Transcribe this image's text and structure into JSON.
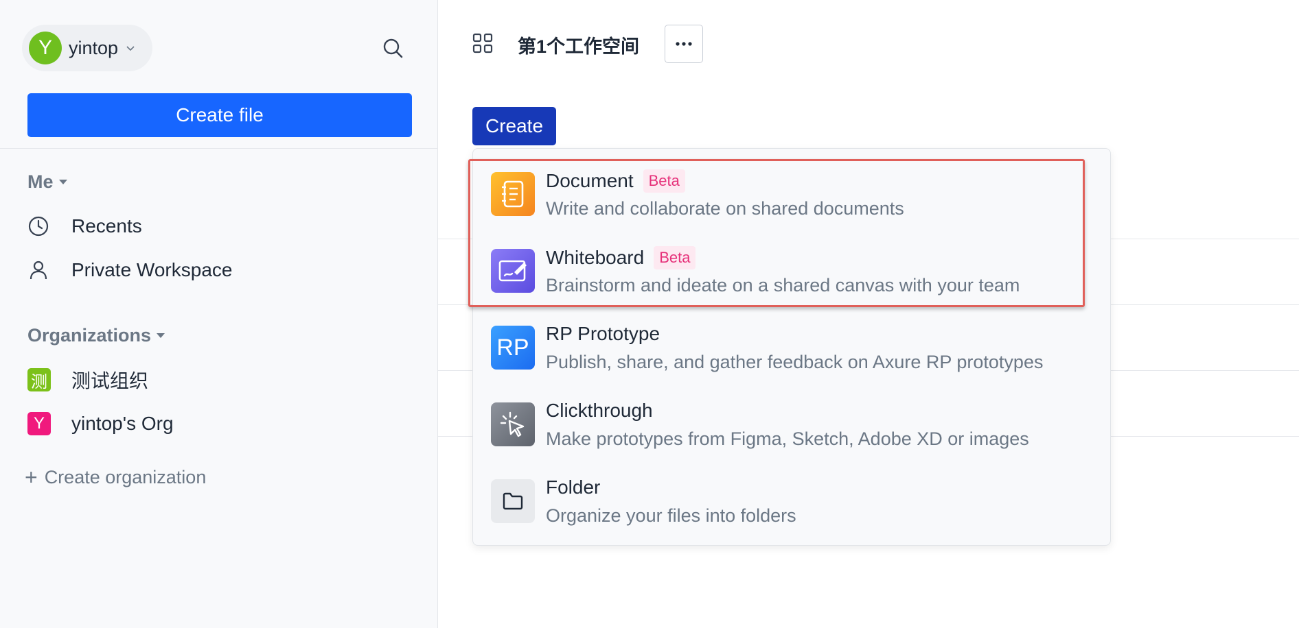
{
  "sidebar": {
    "user": {
      "initial": "Y",
      "name": "yintop",
      "avatar_color": "#6fbf1f"
    },
    "create_file_label": "Create file",
    "me_section": {
      "label": "Me",
      "items": [
        {
          "label": "Recents",
          "icon": "clock-icon"
        },
        {
          "label": "Private Workspace",
          "icon": "person-icon"
        }
      ]
    },
    "org_section": {
      "label": "Organizations",
      "items": [
        {
          "label": "测试组织",
          "badge": "测",
          "badge_color": "#7cc11a"
        },
        {
          "label": "yintop's Org",
          "badge": "Y",
          "badge_color": "#f0197d"
        }
      ]
    },
    "create_org_label": "Create organization"
  },
  "main": {
    "workspace_title": "第1个工作空间",
    "create_label": "Create",
    "menu": [
      {
        "title": "Document",
        "badge": "Beta",
        "desc": "Write and collaborate on shared documents",
        "icon": "document-icon"
      },
      {
        "title": "Whiteboard",
        "badge": "Beta",
        "desc": "Brainstorm and ideate on a shared canvas with your team",
        "icon": "whiteboard-icon"
      },
      {
        "title": "RP Prototype",
        "desc": "Publish, share, and gather feedback on Axure RP prototypes",
        "icon": "rp-icon",
        "icon_text": "RP"
      },
      {
        "title": "Clickthrough",
        "desc": "Make prototypes from Figma, Sketch, Adobe XD or images",
        "icon": "cursor-click-icon"
      },
      {
        "title": "Folder",
        "desc": "Organize your files into folders",
        "icon": "folder-icon"
      }
    ]
  },
  "colors": {
    "primary": "#1766ff",
    "create_button": "#1739b7",
    "highlight_border": "#e0605a",
    "beta_text": "#e6317a"
  }
}
